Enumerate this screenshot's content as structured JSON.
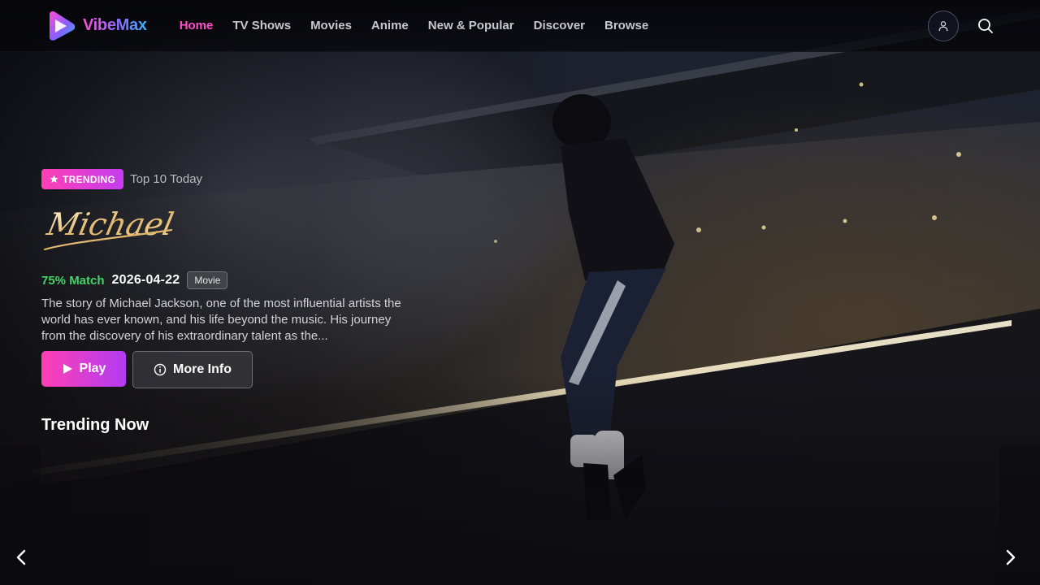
{
  "brand": {
    "name": "VibeMax"
  },
  "nav": {
    "items": [
      {
        "label": "Home",
        "active": true
      },
      {
        "label": "TV Shows",
        "active": false
      },
      {
        "label": "Movies",
        "active": false
      },
      {
        "label": "Anime",
        "active": false
      },
      {
        "label": "New & Popular",
        "active": false
      },
      {
        "label": "Discover",
        "active": false
      },
      {
        "label": "Browse",
        "active": false
      }
    ],
    "icons": {
      "profile": "user-icon",
      "search": "search-icon"
    }
  },
  "hero": {
    "badge": "TRENDING",
    "badge_icon": "star-icon",
    "badge_subtitle": "Top 10 Today",
    "title": "Michael",
    "match": "75% Match",
    "release_date": "2026-04-22",
    "type": "Movie",
    "description": "The story of Michael Jackson, one of the most influential artists the world has ever known, and his life beyond the music. His journey from the discovery of his extraordinary talent as the...",
    "play_label": "Play",
    "info_label": "More Info"
  },
  "sections": {
    "trending_title": "Trending Now"
  },
  "colors": {
    "accent_pink": "#ff4fc8",
    "accent_purple": "#b23cf2",
    "match_green": "#46d369"
  }
}
